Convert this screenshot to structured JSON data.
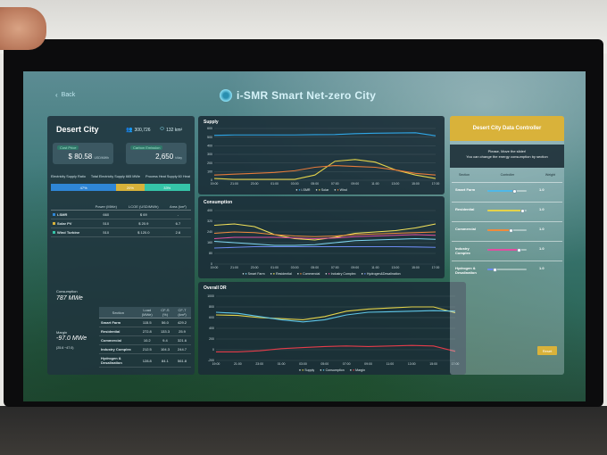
{
  "header": {
    "back_label": "Back",
    "app_title": "i-SMR Smart Net-zero City"
  },
  "city": {
    "name": "Desert City",
    "population": "300,726",
    "area": "132 km²",
    "kpi_left": {
      "label": "Cost Price",
      "value": "$ 80.58",
      "unit": "USD/MWh"
    },
    "kpi_right": {
      "label": "Carbon Emission",
      "value": "2,650",
      "unit": "t/day"
    }
  },
  "supply_ratio": {
    "headers": [
      "Electricity Supply Ratio",
      "Total Electricity Supply 665 MWe",
      "Process Heat Supply 60 Heat"
    ],
    "segments": [
      {
        "label": "47%",
        "color": "#2f86d6",
        "fraction": 0.47
      },
      {
        "label": "20%",
        "color": "#d8b23a",
        "fraction": 0.2
      },
      {
        "label": "33%",
        "color": "#35c4a8",
        "fraction": 0.33
      }
    ]
  },
  "source_table": {
    "columns": [
      "",
      "Power (MWe)",
      "LCOE (USD/MWh)",
      "Area (km²)"
    ],
    "rows": [
      {
        "name": "i-SMR",
        "color": "#2f86d6",
        "cells": [
          "660",
          "$ 69",
          "-"
        ]
      },
      {
        "name": "Solar PV",
        "color": "#d8b23a",
        "cells": [
          "510",
          "$ 20.9",
          "6.7"
        ]
      },
      {
        "name": "Wind Turbine",
        "color": "#35c4a8",
        "cells": [
          "510",
          "$ 120.0",
          "2.6"
        ]
      }
    ]
  },
  "consumption": {
    "label": "Consumption",
    "value": "787 MWe"
  },
  "margin": {
    "label": "Margin",
    "value": "-97.0 MWe",
    "sub": "(25.6 ~47.0)"
  },
  "sector_table": {
    "columns": [
      "Section",
      "Load (MWe)",
      "CF-S (%)",
      "CF-T (km²)"
    ],
    "rows": [
      {
        "name": "Smart Farm",
        "cells": [
          "115.5",
          "56.0",
          "429.2"
        ]
      },
      {
        "name": "Residential",
        "cells": [
          "272.8",
          "133.3",
          "25.9"
        ]
      },
      {
        "name": "Commercial",
        "cells": [
          "10.2",
          "9.4",
          "321.6"
        ]
      },
      {
        "name": "Industry Complex",
        "cells": [
          "212.5",
          "104.3",
          "244.7"
        ]
      },
      {
        "name": "Hydrogen & Desalination",
        "cells": [
          "128.8",
          "84.1",
          "561.8"
        ]
      }
    ]
  },
  "chart_data": [
    {
      "type": "line",
      "title": "Supply",
      "x": [
        "19:00",
        "21:00",
        "23:00",
        "01:00",
        "03:00",
        "05:00",
        "07:00",
        "09:00",
        "11:00",
        "13:00",
        "15:00",
        "17:00"
      ],
      "ylim": [
        0,
        600
      ],
      "yticks": [
        0,
        100,
        200,
        300,
        400,
        500,
        600
      ],
      "series": [
        {
          "name": "i-SMR",
          "color": "#2fa6e6",
          "values": [
            520,
            525,
            525,
            525,
            525,
            528,
            530,
            540,
            545,
            548,
            550,
            515
          ]
        },
        {
          "name": "Solar",
          "color": "#e4d34a",
          "values": [
            20,
            10,
            10,
            10,
            10,
            60,
            220,
            240,
            210,
            120,
            60,
            20
          ]
        },
        {
          "name": "Wind",
          "color": "#e67a3a",
          "values": [
            60,
            70,
            80,
            90,
            110,
            150,
            170,
            160,
            150,
            120,
            80,
            60
          ]
        }
      ]
    },
    {
      "type": "line",
      "title": "Consumption",
      "x": [
        "19:00",
        "21:00",
        "23:00",
        "01:00",
        "03:00",
        "05:00",
        "07:00",
        "09:00",
        "11:00",
        "13:00",
        "15:00",
        "17:00"
      ],
      "ylim": [
        0,
        400
      ],
      "yticks": [
        0,
        80,
        160,
        240,
        320,
        400
      ],
      "series": [
        {
          "name": "Smart Farm",
          "color": "#7fd6f0",
          "values": [
            170,
            160,
            150,
            140,
            140,
            145,
            160,
            175,
            180,
            185,
            190,
            185
          ]
        },
        {
          "name": "Residential",
          "color": "#f3e25a",
          "values": [
            290,
            300,
            280,
            220,
            190,
            180,
            200,
            230,
            240,
            250,
            270,
            300
          ]
        },
        {
          "name": "Commercial",
          "color": "#ef8b3c",
          "values": [
            230,
            240,
            235,
            220,
            210,
            205,
            210,
            220,
            225,
            230,
            235,
            240
          ]
        },
        {
          "name": "Industry Complex",
          "color": "#e04fa0",
          "values": [
            190,
            200,
            200,
            200,
            195,
            190,
            195,
            205,
            210,
            215,
            220,
            215
          ]
        },
        {
          "name": "Hydrogen&Desalination",
          "color": "#6c8af0",
          "values": [
            120,
            125,
            130,
            130,
            130,
            130,
            130,
            130,
            130,
            130,
            128,
            125
          ]
        }
      ]
    },
    {
      "type": "line",
      "title": "Overall DR",
      "x": [
        "19:00",
        "21:00",
        "23:00",
        "01:00",
        "03:00",
        "05:00",
        "07:00",
        "09:00",
        "11:00",
        "13:00",
        "15:00",
        "17:00"
      ],
      "ylim": [
        -200,
        1000
      ],
      "yticks": [
        -200,
        0,
        200,
        400,
        600,
        800,
        1000
      ],
      "series": [
        {
          "name": "Supply",
          "color": "#e4d34a",
          "values": [
            650,
            640,
            600,
            580,
            560,
            620,
            720,
            760,
            780,
            800,
            800,
            690
          ]
        },
        {
          "name": "Consumption",
          "color": "#5fc6e8",
          "values": [
            700,
            680,
            620,
            560,
            520,
            560,
            650,
            700,
            710,
            720,
            730,
            720
          ]
        },
        {
          "name": "Margin",
          "color": "#e53c4a",
          "values": [
            -40,
            -40,
            -20,
            20,
            40,
            60,
            70,
            60,
            70,
            80,
            70,
            -30
          ]
        }
      ]
    }
  ],
  "controller": {
    "title": "Desert City Data Controller",
    "subtitle_1": "Please, Move the slider!",
    "subtitle_2": "You can change the energy consumption by section",
    "columns": [
      "Section",
      "Controller",
      "Weight"
    ],
    "rows": [
      {
        "name": "Smart Farm",
        "color": "#4fb8e8",
        "level": 0.7,
        "weight": "1.0"
      },
      {
        "name": "Residential",
        "color": "#e4d34a",
        "level": 0.9,
        "weight": "1.0"
      },
      {
        "name": "Commercial",
        "color": "#ef8b3c",
        "level": 0.6,
        "weight": "1.0"
      },
      {
        "name": "Industry Complex",
        "color": "#e04fa0",
        "level": 0.8,
        "weight": "1.0"
      },
      {
        "name": "Hydrogen & Desalination",
        "color": "#6c8af0",
        "level": 0.2,
        "weight": "1.0"
      }
    ],
    "reset_label": "Reset"
  }
}
